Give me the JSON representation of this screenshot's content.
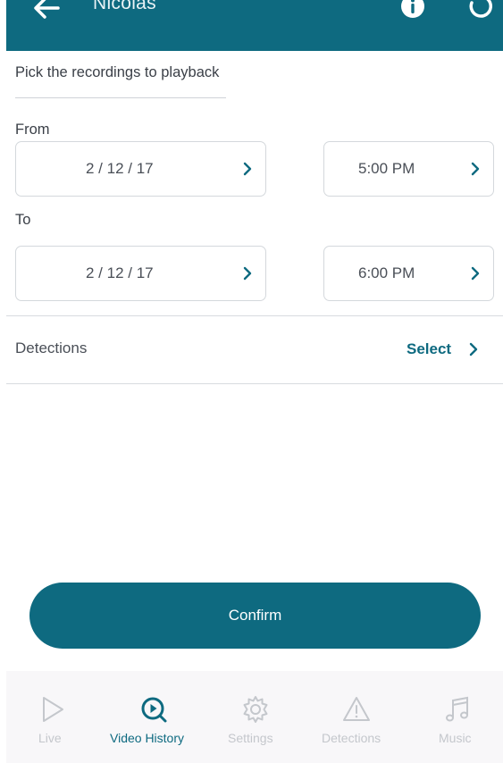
{
  "header": {
    "title": "Nicolas"
  },
  "form": {
    "title": "Pick the recordings to playback",
    "from_label": "From",
    "to_label": "To",
    "from_date": "2 / 12 / 17",
    "from_time": "5:00 PM",
    "to_date": "2 / 12 / 17",
    "to_time": "6:00 PM"
  },
  "detections": {
    "label": "Detections",
    "action": "Select"
  },
  "confirm_label": "Confirm",
  "tabs": [
    {
      "label": "Live",
      "icon": "play-icon",
      "active": false
    },
    {
      "label": "Video History",
      "icon": "video-history-icon",
      "active": true
    },
    {
      "label": "Settings",
      "icon": "gear-icon",
      "active": false
    },
    {
      "label": "Detections",
      "icon": "warning-icon",
      "active": false
    },
    {
      "label": "Music",
      "icon": "music-note-icon",
      "active": false
    }
  ],
  "colors": {
    "primary": "#0e6a80",
    "inactive": "#c4c7cc",
    "tabbar_bg": "#f8f7f9"
  }
}
